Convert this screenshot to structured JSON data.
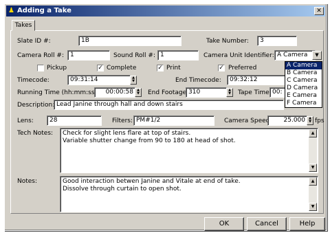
{
  "window": {
    "title": "Adding a Take",
    "close_glyph": "✕",
    "icon": "person-icon"
  },
  "tabs": [
    {
      "label": "Takes"
    }
  ],
  "fields": {
    "slate_label": "Slate ID #:",
    "slate_value": "1B",
    "take_label": "Take Number:",
    "take_value": "3",
    "camera_roll_label": "Camera Roll #:",
    "camera_roll_value": "1",
    "sound_roll_label": "Sound Roll #:",
    "sound_roll_value": "1",
    "camera_unit_label": "Camera Unit Identifier:",
    "camera_unit_value": "A Camera",
    "pickup_label": "Pickup",
    "complete_label": "Complete",
    "print_label": "Print",
    "preferred_label": "Preferred",
    "timecode_label": "Timecode:",
    "timecode_value": "09:31:14",
    "end_timecode_label": "End Timecode:",
    "end_timecode_value": "09:32:12",
    "running_time_label": "Running Time (hh:mm:ss):",
    "running_time_value": "00:00:58",
    "end_footage_label": "End Footage:",
    "end_footage_value": "310",
    "tape_time_label": "Tape Time:",
    "tape_time_value": "00:",
    "description_label": "Description:",
    "description_value": "Lead Janine through hall and down stairs",
    "lens_label": "Lens:",
    "lens_value": "28",
    "filters_label": "Filters:",
    "filters_value": "PM#1/2",
    "camera_speed_label": "Camera Speed:",
    "camera_speed_value": "25.000",
    "fps_label": "fps",
    "tech_notes_label": "Tech Notes:",
    "tech_notes_line1": "Check for slight lens flare at top of stairs.",
    "tech_notes_line2": "Variable shutter change from 90 to 180 at head of shot.",
    "notes_label": "Notes:",
    "notes_line1": "Good interaction betwen Janine and Vitale at end of take.",
    "notes_line2": "Dissolve through curtain to open shot."
  },
  "checkboxes": {
    "pickup": false,
    "complete": true,
    "print": true,
    "preferred": true
  },
  "camera_options": [
    "A Camera",
    "B Camera",
    "C Camera",
    "D Camera",
    "E Camera",
    "F Camera"
  ],
  "buttons": {
    "ok": "OK",
    "cancel": "Cancel",
    "help": "Help"
  },
  "colors": {
    "title_start": "#0a246a",
    "title_end": "#a6caf0",
    "face": "#d4d0c8",
    "selection": "#0a246a"
  }
}
